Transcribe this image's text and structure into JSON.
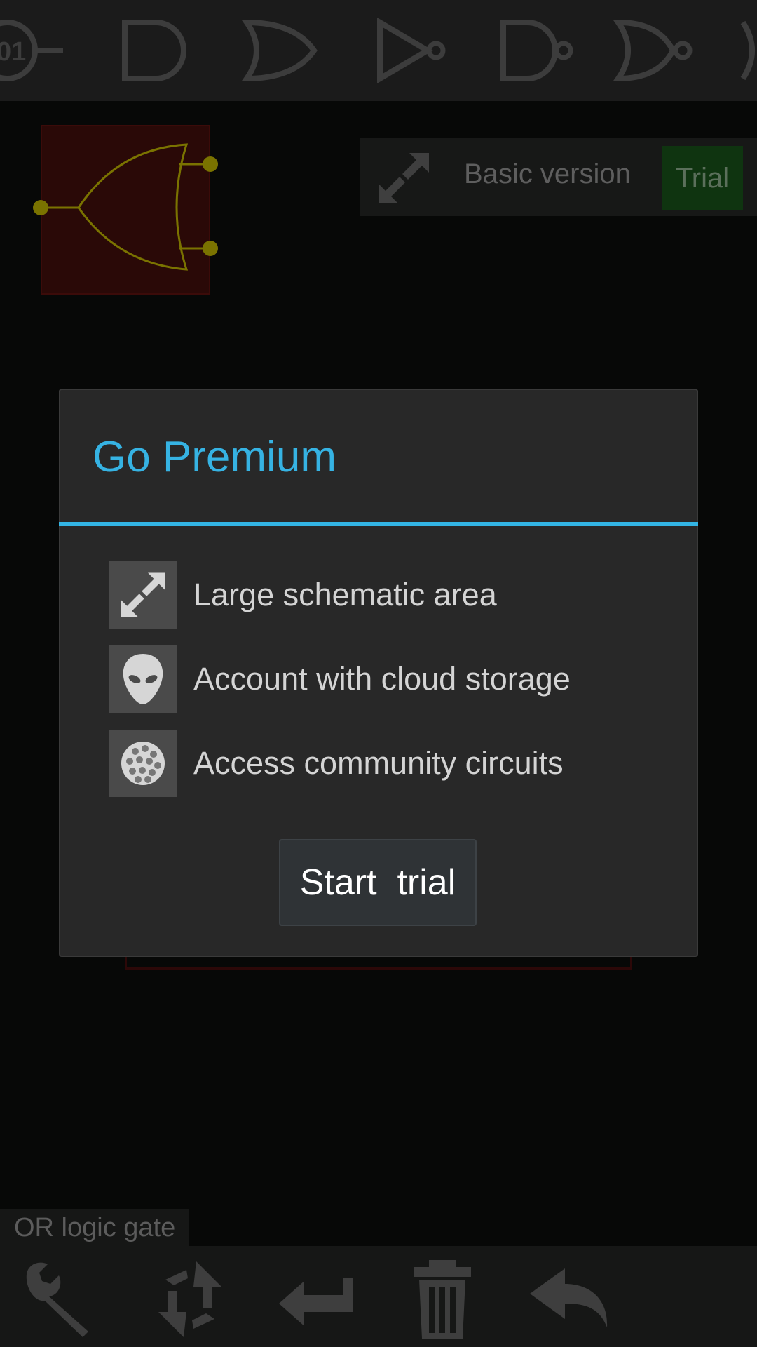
{
  "palette": {
    "gates": [
      "input-gate-icon",
      "and-gate-icon",
      "or-gate-icon",
      "not-gate-icon",
      "nand-gate-icon",
      "nor-gate-icon",
      "xor-gate-icon"
    ]
  },
  "canvas": {
    "selected_component": "or-gate-icon",
    "version_label": "Basic version",
    "trial_label": "Trial"
  },
  "dialog": {
    "title": "Go Premium",
    "features": [
      {
        "icon": "expand-arrows-icon",
        "label": "Large schematic area"
      },
      {
        "icon": "alien-account-icon",
        "label": "Account with cloud storage"
      },
      {
        "icon": "globe-icon",
        "label": "Access community circuits"
      }
    ],
    "button_label": "Start  trial"
  },
  "status": {
    "label": "OR logic gate"
  },
  "toolbar": {
    "tools": [
      "wrench-icon",
      "rotate-icon",
      "flip-icon",
      "trash-icon",
      "undo-icon"
    ]
  },
  "colors": {
    "accent": "#33b5e5",
    "trial_green": "#0f3410",
    "gate_yellow": "#7a7300",
    "gate_bg": "#2a0907"
  }
}
